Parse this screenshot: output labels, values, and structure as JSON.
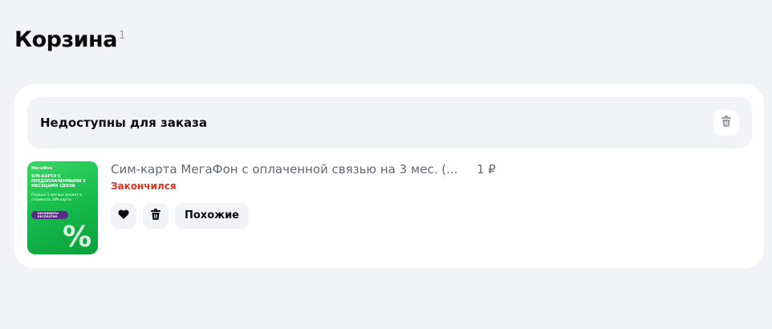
{
  "page": {
    "title": "Корзина",
    "count": "1"
  },
  "unavailable_section": {
    "title": "Недоступны для заказа",
    "delete_all_icon": "trash-icon"
  },
  "item": {
    "name": "Сим-карта МегаФон с оплаченной связью на 3 мес. (...",
    "price": "1 ₽",
    "status": "Закончился",
    "status_color": "#e0321e",
    "thumbnail": {
      "brand": "МегаФон",
      "headline": "SIM-КАРТА С ПРЕДОПЛАЧЕННЫМИ 3 МЕСЯЦАМИ СВЯЗИ",
      "subtext": "Первые 3 месяца входят в стоимость SIM-карты",
      "pill": "БЕЗЛИМИТЫ БЕСПЛАТНО",
      "accent_color": "#13b94a"
    },
    "actions": {
      "favorite_icon": "heart-icon",
      "delete_icon": "trash-icon",
      "similar_label": "Похожие"
    }
  }
}
